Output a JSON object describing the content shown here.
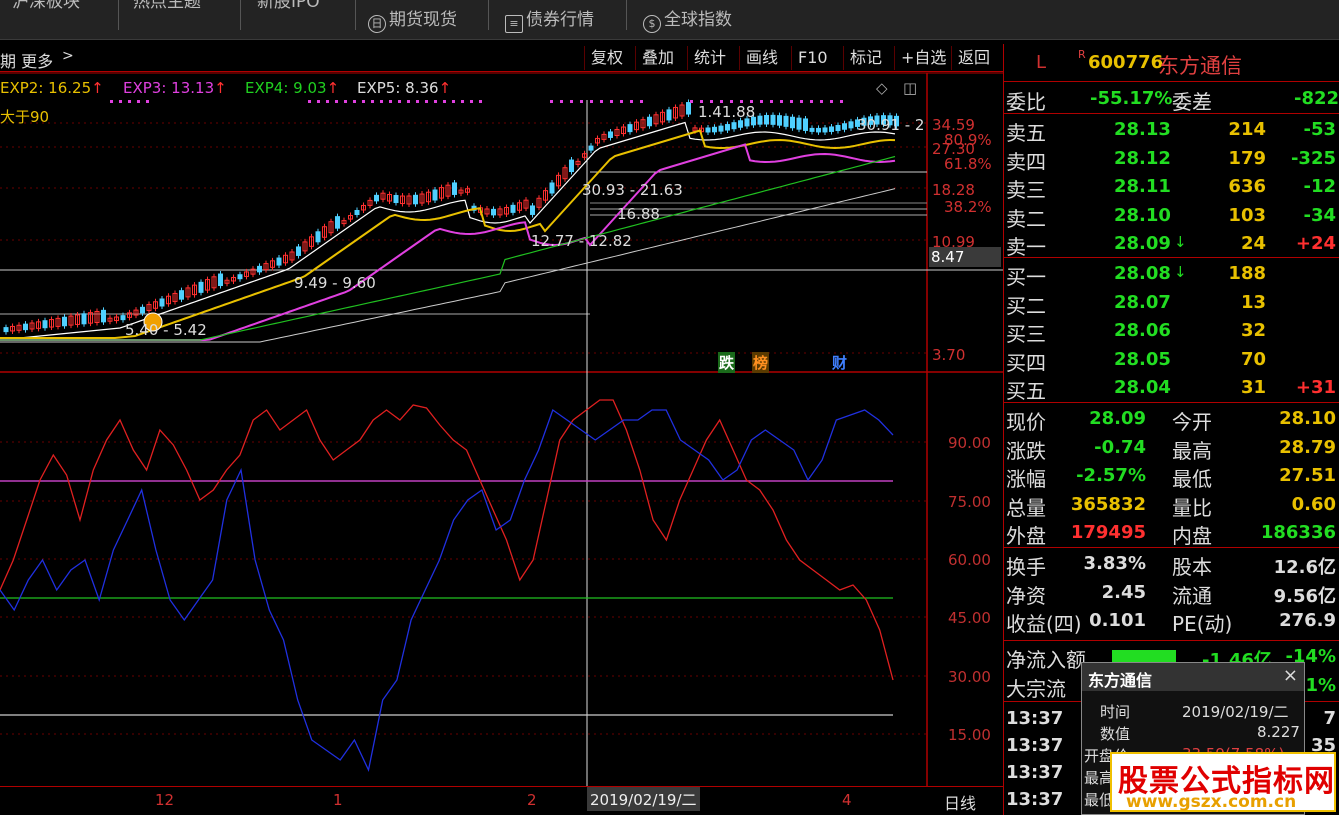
{
  "top_tabs": [
    "沪深板块",
    "热点主题",
    "新股IPO",
    "期货现货",
    "债券行情",
    "全球指数"
  ],
  "toolbar": {
    "left_label": "期  更多",
    "buttons": [
      "复权",
      "叠加",
      "统计",
      "画线",
      "F10",
      "标记",
      "+自选",
      "返回"
    ]
  },
  "legend": [
    {
      "label": "EXP2: 16.25",
      "color": "#e8c000"
    },
    {
      "label": "EXP3: 13.13",
      "color": "#e040e0"
    },
    {
      "label": "EXP4: 9.03",
      "color": "#20d020"
    },
    {
      "label": "EXP5: 8.36",
      "color": "#dddddd"
    }
  ],
  "condition_text": "大于90",
  "price_axis": [
    "34.59",
    "27.30",
    "18.28",
    "10.99",
    "3.70"
  ],
  "fib_levels": [
    "80.9%",
    "61.8%",
    "38.2%"
  ],
  "osc_axis": [
    "90.00",
    "75.00",
    "60.00",
    "45.00",
    "30.00",
    "15.00"
  ],
  "cursor_value": "8.47",
  "annotations": [
    "30.91 - 2",
    "1.41.88",
    "30.93 - 21.63",
    "16.88",
    "12.77 - 12.82",
    "9.49 - 9.60",
    "5.40 - 5.42"
  ],
  "flags": [
    {
      "text": "跌",
      "bg": "#1a6a1a",
      "color": "#ffffff"
    },
    {
      "text": "榜",
      "bg": "#5a3a00",
      "color": "#ff9020"
    },
    {
      "text": "财",
      "bg": "#000000",
      "color": "#4080ff"
    }
  ],
  "x_axis": [
    "12",
    "1",
    "2",
    "4"
  ],
  "current_date": "2019/02/19/二",
  "period": "日线",
  "stock": {
    "market": "L",
    "flag": "R",
    "code": "600776",
    "name": "东方通信"
  },
  "wei": {
    "ratio_label": "委比",
    "ratio": "-55.17%",
    "diff_label": "委差",
    "diff": "-822"
  },
  "asks": [
    {
      "label": "卖五",
      "price": "28.13",
      "vol": "214",
      "chg": "-53",
      "arrow": ""
    },
    {
      "label": "卖四",
      "price": "28.12",
      "vol": "179",
      "chg": "-325",
      "arrow": ""
    },
    {
      "label": "卖三",
      "price": "28.11",
      "vol": "636",
      "chg": "-12",
      "arrow": ""
    },
    {
      "label": "卖二",
      "price": "28.10",
      "vol": "103",
      "chg": "-34",
      "arrow": ""
    },
    {
      "label": "卖一",
      "price": "28.09",
      "vol": "24",
      "chg": "+24",
      "arrow": "↓"
    }
  ],
  "bids": [
    {
      "label": "买一",
      "price": "28.08",
      "vol": "188",
      "chg": "",
      "arrow": "↓"
    },
    {
      "label": "买二",
      "price": "28.07",
      "vol": "13",
      "chg": "",
      "arrow": ""
    },
    {
      "label": "买三",
      "price": "28.06",
      "vol": "32",
      "chg": "",
      "arrow": ""
    },
    {
      "label": "买四",
      "price": "28.05",
      "vol": "70",
      "chg": "",
      "arrow": ""
    },
    {
      "label": "买五",
      "price": "28.04",
      "vol": "31",
      "chg": "+31",
      "arrow": ""
    }
  ],
  "quote": [
    {
      "k1": "现价",
      "v1": "28.09",
      "k2": "今开",
      "v2": "28.10"
    },
    {
      "k1": "涨跌",
      "v1": "-0.74",
      "k2": "最高",
      "v2": "28.79"
    },
    {
      "k1": "涨幅",
      "v1": "-2.57%",
      "k2": "最低",
      "v2": "27.51"
    },
    {
      "k1": "总量",
      "v1": "365832",
      "k2": "量比",
      "v2": "0.60"
    },
    {
      "k1": "外盘",
      "v1": "179495",
      "k2": "内盘",
      "v2": "186336"
    }
  ],
  "fund": [
    {
      "k1": "换手",
      "v1": "3.83%",
      "k2": "股本",
      "v2": "12.6亿"
    },
    {
      "k1": "净资",
      "v1": "2.45",
      "k2": "流通",
      "v2": "9.56亿"
    },
    {
      "k1": "收益(四)",
      "v1": "0.101",
      "k2": "PE(动)",
      "v2": "276.9"
    }
  ],
  "flow": [
    {
      "k": "净流入额",
      "v": "-1.46亿",
      "p": "-14%"
    },
    {
      "k": "大宗流",
      "v": "",
      "p": "1%"
    }
  ],
  "ticks": [
    {
      "time": "13:37",
      "v": "7"
    },
    {
      "time": "13:37",
      "v": "35"
    },
    {
      "time": "13:37",
      "v": ""
    },
    {
      "time": "13:37",
      "v": ""
    }
  ],
  "popup": {
    "title": "东方通信",
    "rows": [
      {
        "k": "时间",
        "v": "2019/02/19/二"
      },
      {
        "k": "数值",
        "v": "8.227"
      },
      {
        "k": "开盘价",
        "v": "33.59(7.58%)"
      },
      {
        "k": "最高",
        "v": ""
      },
      {
        "k": "最低",
        "v": ""
      }
    ]
  },
  "watermark": {
    "main": "股票公式指标网",
    "url": "www.gszx.com.cn"
  }
}
